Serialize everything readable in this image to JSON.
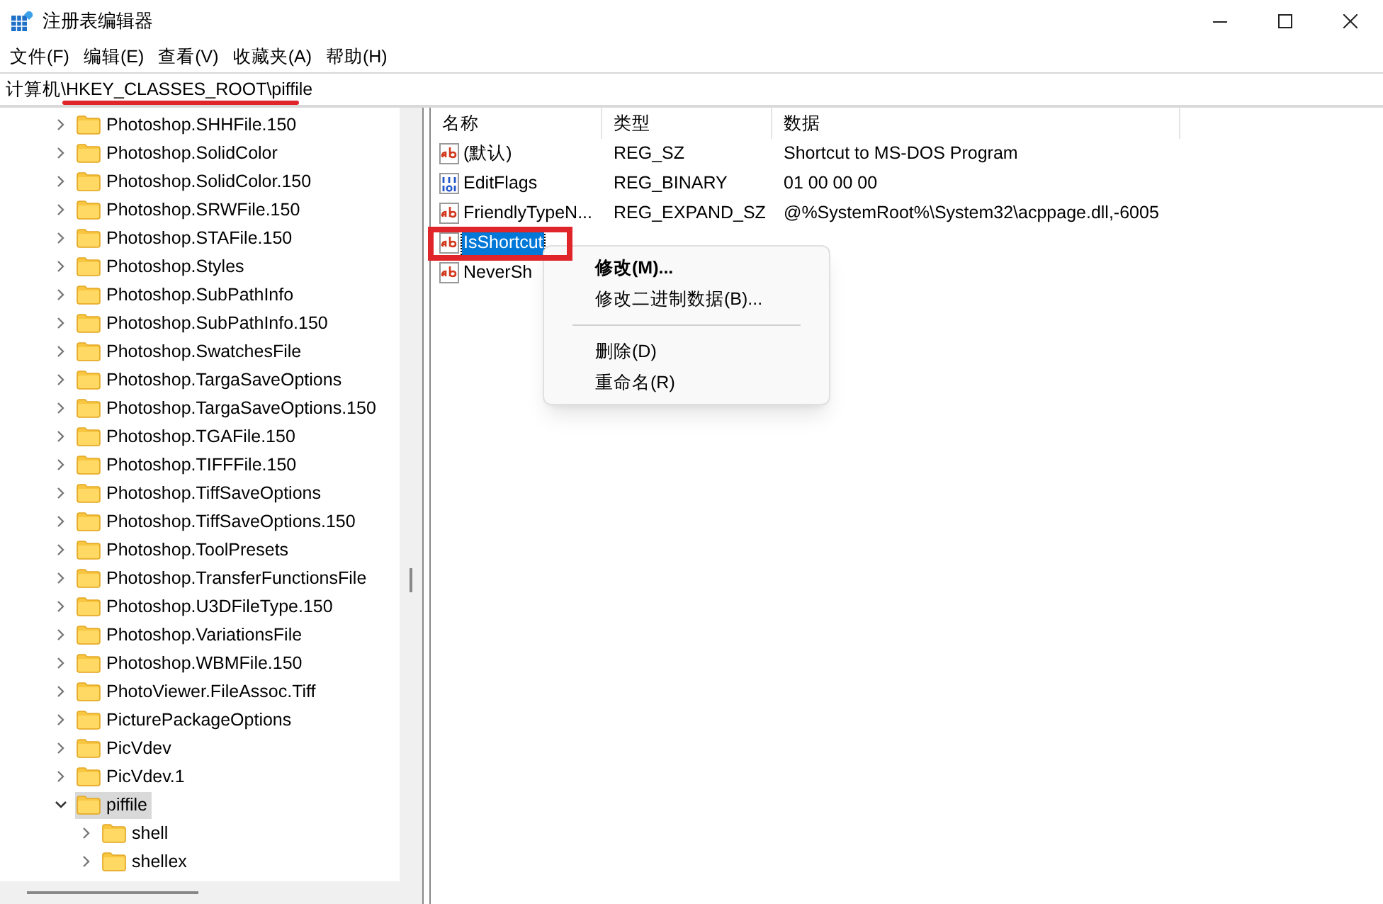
{
  "window": {
    "title": "注册表编辑器"
  },
  "menu": [
    "文件(F)",
    "编辑(E)",
    "查看(V)",
    "收藏夹(A)",
    "帮助(H)"
  ],
  "address": {
    "root": "计算机\\",
    "path": "HKEY_CLASSES_ROOT\\piffile"
  },
  "tree": [
    {
      "label": "Photoshop.SHHFile.150",
      "expanded": false,
      "selected": false
    },
    {
      "label": "Photoshop.SolidColor",
      "expanded": false,
      "selected": false
    },
    {
      "label": "Photoshop.SolidColor.150",
      "expanded": false,
      "selected": false
    },
    {
      "label": "Photoshop.SRWFile.150",
      "expanded": false,
      "selected": false
    },
    {
      "label": "Photoshop.STAFile.150",
      "expanded": false,
      "selected": false
    },
    {
      "label": "Photoshop.Styles",
      "expanded": false,
      "selected": false
    },
    {
      "label": "Photoshop.SubPathInfo",
      "expanded": false,
      "selected": false
    },
    {
      "label": "Photoshop.SubPathInfo.150",
      "expanded": false,
      "selected": false
    },
    {
      "label": "Photoshop.SwatchesFile",
      "expanded": false,
      "selected": false
    },
    {
      "label": "Photoshop.TargaSaveOptions",
      "expanded": false,
      "selected": false
    },
    {
      "label": "Photoshop.TargaSaveOptions.150",
      "expanded": false,
      "selected": false
    },
    {
      "label": "Photoshop.TGAFile.150",
      "expanded": false,
      "selected": false
    },
    {
      "label": "Photoshop.TIFFFile.150",
      "expanded": false,
      "selected": false
    },
    {
      "label": "Photoshop.TiffSaveOptions",
      "expanded": false,
      "selected": false
    },
    {
      "label": "Photoshop.TiffSaveOptions.150",
      "expanded": false,
      "selected": false
    },
    {
      "label": "Photoshop.ToolPresets",
      "expanded": false,
      "selected": false
    },
    {
      "label": "Photoshop.TransferFunctionsFile",
      "expanded": false,
      "selected": false
    },
    {
      "label": "Photoshop.U3DFileType.150",
      "expanded": false,
      "selected": false
    },
    {
      "label": "Photoshop.VariationsFile",
      "expanded": false,
      "selected": false
    },
    {
      "label": "Photoshop.WBMFile.150",
      "expanded": false,
      "selected": false
    },
    {
      "label": "PhotoViewer.FileAssoc.Tiff",
      "expanded": false,
      "selected": false
    },
    {
      "label": "PicturePackageOptions",
      "expanded": false,
      "selected": false
    },
    {
      "label": "PicVdev",
      "expanded": false,
      "selected": false
    },
    {
      "label": "PicVdev.1",
      "expanded": false,
      "selected": false
    },
    {
      "label": "piffile",
      "expanded": true,
      "selected": true,
      "children": [
        {
          "label": "shell",
          "expanded": false,
          "selected": false
        },
        {
          "label": "shellex",
          "expanded": false,
          "selected": false
        }
      ]
    }
  ],
  "columns": [
    "名称",
    "类型",
    "数据"
  ],
  "values": [
    {
      "kind": "string",
      "name": "(默认)",
      "type": "REG_SZ",
      "data": "Shortcut to MS-DOS Program",
      "selected": false
    },
    {
      "kind": "binary",
      "name": "EditFlags",
      "type": "REG_BINARY",
      "data": "01 00 00 00",
      "selected": false
    },
    {
      "kind": "string",
      "name": "FriendlyTypeN...",
      "type": "REG_EXPAND_SZ",
      "data": "@%SystemRoot%\\System32\\acppage.dll,-6005",
      "selected": false
    },
    {
      "kind": "string",
      "name": "IsShortcut",
      "selected": true
    },
    {
      "kind": "string",
      "name": "NeverSh",
      "selected": false
    }
  ],
  "context_menu": [
    {
      "kind": "item",
      "label": "修改(M)...",
      "default": true
    },
    {
      "kind": "item",
      "label": "修改二进制数据(B)...",
      "default": false
    },
    {
      "kind": "separator"
    },
    {
      "kind": "item",
      "label": "删除(D)",
      "default": false
    },
    {
      "kind": "item",
      "label": "重命名(R)",
      "default": false
    }
  ]
}
